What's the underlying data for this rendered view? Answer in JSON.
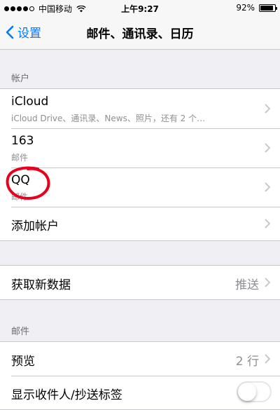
{
  "status_bar": {
    "carrier": "中国移动",
    "time": "上午9:27",
    "battery": "92%",
    "battery_level": 0.92
  },
  "nav": {
    "back_label": "设置",
    "title": "邮件、通讯录、日历"
  },
  "accounts_section": {
    "header": "帐户",
    "items": [
      {
        "title": "iCloud",
        "subtitle": "iCloud Drive、通讯录、News、照片，还有 2 个…"
      },
      {
        "title": "163",
        "subtitle": "邮件"
      },
      {
        "title": "QQ",
        "subtitle": "邮件"
      },
      {
        "title": "添加帐户"
      }
    ]
  },
  "fetch": {
    "label": "获取新数据",
    "value": "推送"
  },
  "mail_section": {
    "header": "邮件",
    "preview_label": "预览",
    "preview_value": "2 行",
    "show_to_cc_label": "显示收件人/抄送标签",
    "show_to_cc_on": false
  },
  "colors": {
    "accent": "#007aff",
    "annotation": "#e8001c"
  }
}
